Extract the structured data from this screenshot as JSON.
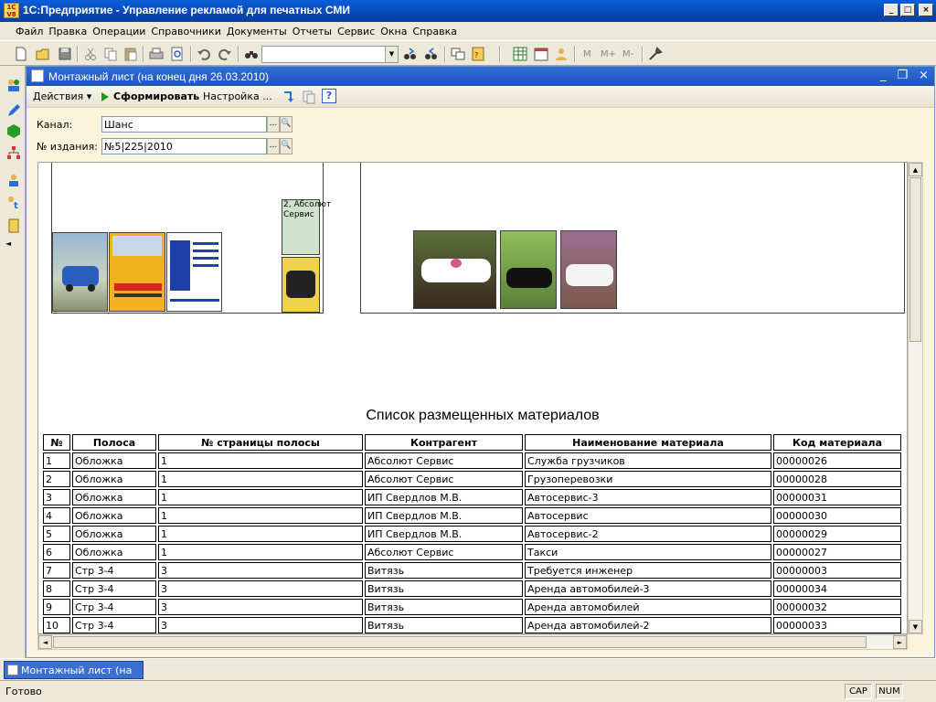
{
  "window": {
    "title": "1С:Предприятие - Управление рекламой для печатных СМИ"
  },
  "menu": [
    "Файл",
    "Правка",
    "Операции",
    "Справочники",
    "Документы",
    "Отчеты",
    "Сервис",
    "Окна",
    "Справка"
  ],
  "toolbar": {
    "memory_buttons": [
      "M",
      "M+",
      "M-"
    ]
  },
  "child_window": {
    "title": "Монтажный лист (на конец дня 26.03.2010)",
    "actions_label": "Действия",
    "generate_label": "Сформировать",
    "settings_label": "Настройка ...",
    "help_label": "?"
  },
  "form": {
    "channel_label": "Канал:",
    "channel_value": "Шанс",
    "issue_label": "№ издания:",
    "issue_value": "№5|225|2010"
  },
  "layout": {
    "ad_label_line1": "2, Абсолют",
    "ad_label_line2": "Сервис"
  },
  "report": {
    "heading": "Список размещенных материалов",
    "columns": [
      "№",
      "Полоса",
      "№ страницы полосы",
      "Контрагент",
      "Наименование материала",
      "Код материала"
    ],
    "rows": [
      [
        "1",
        "Обложка",
        "1",
        "Абсолют Сервис",
        "Служба грузчиков",
        "00000026"
      ],
      [
        "2",
        "Обложка",
        "1",
        "Абсолют Сервис",
        "Грузоперевозки",
        "00000028"
      ],
      [
        "3",
        "Обложка",
        "1",
        "ИП Свердлов М.В.",
        "Автосервис-3",
        "00000031"
      ],
      [
        "4",
        "Обложка",
        "1",
        "ИП Свердлов М.В.",
        "Автосервис",
        "00000030"
      ],
      [
        "5",
        "Обложка",
        "1",
        "ИП Свердлов М.В.",
        "Автосервис-2",
        "00000029"
      ],
      [
        "6",
        "Обложка",
        "1",
        "Абсолют Сервис",
        "Такси",
        "00000027"
      ],
      [
        "7",
        "Стр 3-4",
        "3",
        "Витязь",
        "Требуется инженер",
        "00000003"
      ],
      [
        "8",
        "Стр 3-4",
        "3",
        "Витязь",
        "Аренда автомобилей-3",
        "00000034"
      ],
      [
        "9",
        "Стр 3-4",
        "3",
        "Витязь",
        "Аренда автомобилей",
        "00000032"
      ],
      [
        "10",
        "Стр 3-4",
        "3",
        "Витязь",
        "Аренда автомобилей-2",
        "00000033"
      ]
    ]
  },
  "taskbar": {
    "tab_label": "Монтажный лист (на к..."
  },
  "status": {
    "text": "Готово",
    "cap": "CAP",
    "num": "NUM"
  }
}
